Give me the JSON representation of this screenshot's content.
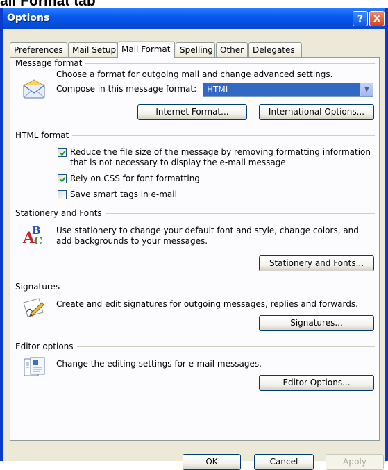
{
  "page_heading": "ail Format tab",
  "window": {
    "title": "Options",
    "help_label": "?",
    "close_label": "X"
  },
  "tabs": [
    {
      "label": "Preferences",
      "active": false
    },
    {
      "label": "Mail Setup",
      "active": false
    },
    {
      "label": "Mail Format",
      "active": true
    },
    {
      "label": "Spelling",
      "active": false
    },
    {
      "label": "Other",
      "active": false
    },
    {
      "label": "Delegates",
      "active": false
    }
  ],
  "message_format": {
    "title": "Message format",
    "description": "Choose a format for outgoing mail and change advanced settings.",
    "compose_label": "Compose in this message format:",
    "compose_value": "HTML",
    "internet_format_button": "Internet Format...",
    "international_options_button": "International Options...",
    "icon": "envelope-icon"
  },
  "html_format": {
    "title": "HTML format",
    "reduce_size_line1": "Reduce the file size of the message by removing formatting information",
    "reduce_size_line2": "that is not necessary to display the e-mail message",
    "reduce_size_checked": true,
    "rely_css_label": "Rely on CSS for font formatting",
    "rely_css_checked": true,
    "smart_tags_label": "Save smart tags in e-mail",
    "smart_tags_checked": false
  },
  "stationery": {
    "title": "Stationery and Fonts",
    "description_line1": "Use stationery to change your default font and style, change colors, and",
    "description_line2": "add backgrounds to your messages.",
    "button": "Stationery and Fonts...",
    "icon": "fonts-abc-icon"
  },
  "signatures": {
    "title": "Signatures",
    "description": "Create and edit signatures for outgoing messages, replies and forwards.",
    "button": "Signatures...",
    "icon": "signature-pen-icon"
  },
  "editor": {
    "title": "Editor options",
    "description": "Change the editing settings for e-mail messages.",
    "button": "Editor Options...",
    "icon": "document-editor-icon"
  },
  "footer": {
    "ok": "OK",
    "cancel": "Cancel",
    "apply": "Apply"
  },
  "colors": {
    "titlebar": "#0859ec",
    "dialog_bg": "#ece9d8",
    "selection": "#316ac5",
    "active_tab_accent": "#ffc83c"
  }
}
